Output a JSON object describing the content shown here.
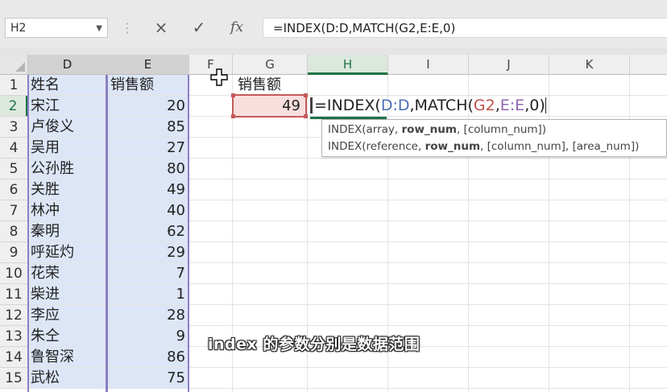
{
  "namebox": {
    "value": "H2"
  },
  "formula_bar": {
    "cancel_icon": "×",
    "enter_icon": "✓",
    "fx_label": "fx",
    "formula": "=INDEX(D:D,MATCH(G2,E:E,0)"
  },
  "columns": [
    "D",
    "E",
    "F",
    "G",
    "H",
    "I",
    "J",
    "K"
  ],
  "rows": [
    "1",
    "2",
    "3",
    "4",
    "5",
    "6",
    "7",
    "8",
    "9",
    "10",
    "11",
    "12",
    "13",
    "14",
    "15"
  ],
  "sheet": {
    "d_header": "姓名",
    "e_header": "销售额",
    "g_header": "销售额",
    "g2_value": "49",
    "names": [
      "宋江",
      "卢俊义",
      "吴用",
      "公孙胜",
      "关胜",
      "林冲",
      "秦明",
      "呼延灼",
      "花荣",
      "柴进",
      "李应",
      "朱仝",
      "鲁智深",
      "武松"
    ],
    "sales": [
      "20",
      "85",
      "27",
      "80",
      "49",
      "40",
      "62",
      "29",
      "7",
      "1",
      "28",
      "9",
      "86",
      "75"
    ]
  },
  "edit": {
    "prefix": "=INDEX(",
    "arg1": "D:D",
    "mid": ",MATCH(",
    "arg2": "G2",
    "sep": ",",
    "arg3": "E:E",
    "tail": ",0)"
  },
  "tooltip": {
    "line1_pre": "INDEX(array, ",
    "line1_bold": "row_num",
    "line1_post": ", [column_num])",
    "line2_pre": "INDEX(reference, ",
    "line2_bold": "row_num",
    "line2_post": ", [column_num], [area_num])"
  },
  "subtitle": "index 的参数分别是数据范围",
  "colors": {
    "accent": "#217346",
    "range_fill": "#dde6f6",
    "range_border": "#8c7fc3",
    "ref_red": "#c0504d"
  }
}
